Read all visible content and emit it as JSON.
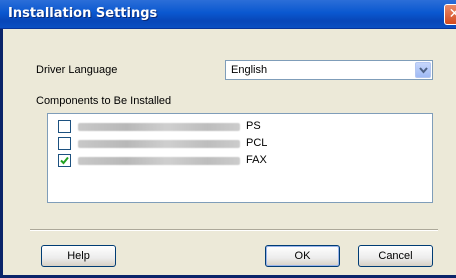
{
  "window": {
    "title": "Installation Settings",
    "close_glyph": "✕"
  },
  "driver_language": {
    "label": "Driver Language",
    "selected": "English"
  },
  "components": {
    "label": "Components to Be Installed",
    "items": [
      {
        "suffix": "PS",
        "checked": false
      },
      {
        "suffix": "PCL",
        "checked": false
      },
      {
        "suffix": "FAX",
        "checked": true
      }
    ]
  },
  "buttons": {
    "help": "Help",
    "ok": "OK",
    "cancel": "Cancel"
  },
  "colors": {
    "titlebar": "#0a58d0",
    "dialog_bg": "#ece9d8",
    "check": "#21a121"
  }
}
